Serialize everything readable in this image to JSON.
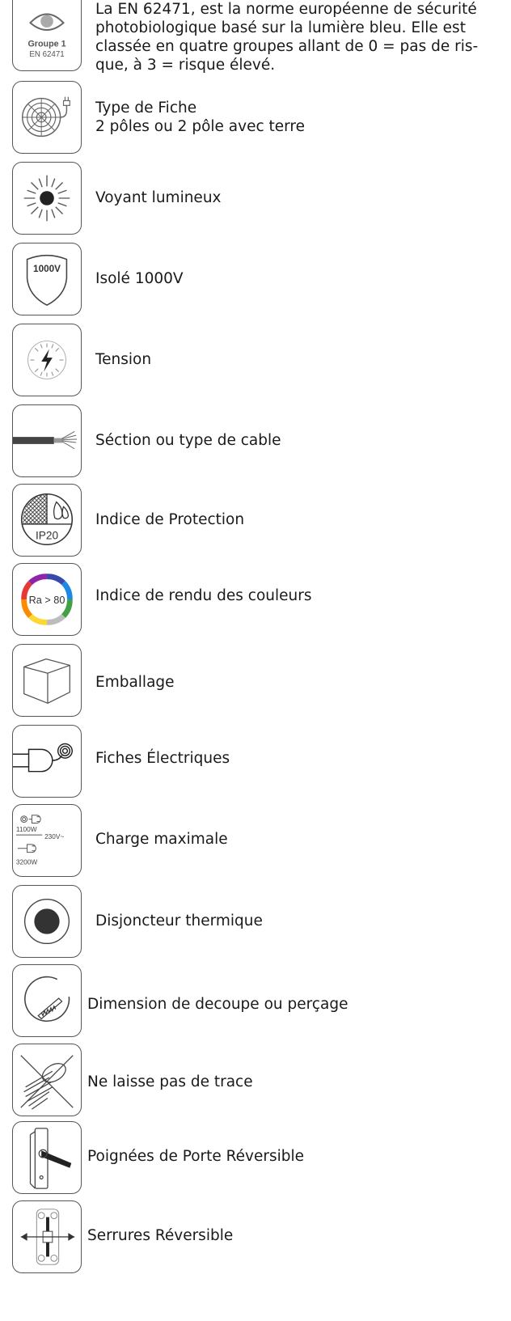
{
  "items": [
    {
      "icon": "eye-group-icon",
      "icon_text": [
        "Groupe 1",
        "EN 62471"
      ],
      "lines": [
        "La EN 62471, est la norme européenne de sécurité",
        "photobiologique basé sur la lumière bleu. Elle est",
        "classée en quatre groupes allant de 0 = pas de ris-",
        "que, à 3 = risque élevé."
      ]
    },
    {
      "icon": "cable-reel-plug-icon",
      "lines": [
        "Type de Fiche",
        "2 pôles ou 2 pôle avec terre"
      ]
    },
    {
      "icon": "indicator-light-icon",
      "label": "Voyant lumineux"
    },
    {
      "icon": "shield-1000v-icon",
      "icon_text": "1000V",
      "label": "Isolé 1000V"
    },
    {
      "icon": "voltage-dial-icon",
      "label": "Tension"
    },
    {
      "icon": "cable-section-icon",
      "label": "Séction ou type de cable"
    },
    {
      "icon": "ip20-protection-icon",
      "icon_text": "IP20",
      "label": "Indice de Protection"
    },
    {
      "icon": "color-rendering-icon",
      "icon_text": "Ra > 80",
      "label": "Indice de rendu des couleurs"
    },
    {
      "icon": "package-box-icon",
      "label": "Emballage"
    },
    {
      "icon": "electric-plug-icon",
      "label": "Fiches Électriques"
    },
    {
      "icon": "max-load-icon",
      "icon_text": [
        "1100W",
        "230V~",
        "3200W"
      ],
      "label": "Charge maximale"
    },
    {
      "icon": "thermal-breaker-icon",
      "label": "Disjoncteur thermique"
    },
    {
      "icon": "saw-cut-icon",
      "label": "Dimension de decoupe ou perçage"
    },
    {
      "icon": "no-trace-icon",
      "label": "Ne laisse  pas de trace"
    },
    {
      "icon": "door-handle-icon",
      "label": "Poignées de Porte Réversible"
    },
    {
      "icon": "reversible-lock-icon",
      "label": "Serrures Réversible"
    }
  ]
}
